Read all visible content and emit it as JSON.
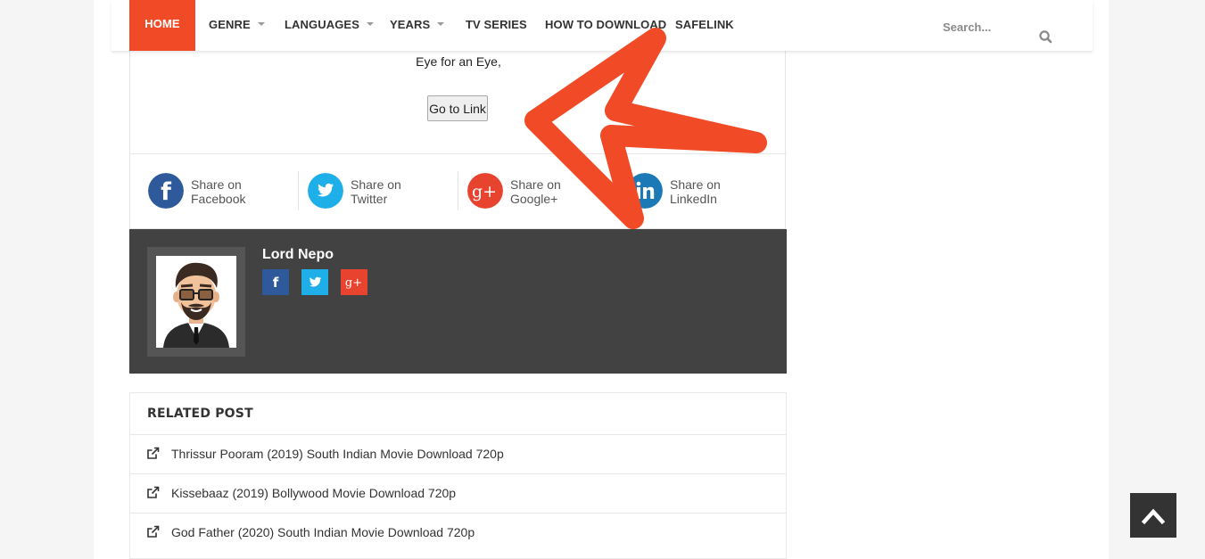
{
  "nav": {
    "items": [
      {
        "label": "HOME",
        "active": true
      },
      {
        "label": "GENRE",
        "dropdown": true
      },
      {
        "label": "LANGUAGES",
        "dropdown": true
      },
      {
        "label": "YEARS",
        "dropdown": true
      },
      {
        "label": "TV SERIES"
      },
      {
        "label": "HOW TO DOWNLOAD"
      },
      {
        "label": "SAFELINK"
      }
    ],
    "search_placeholder": "Search...",
    "accent": "#f04a26"
  },
  "post": {
    "text": "Eye for an Eye,",
    "button_label": "Go to Link"
  },
  "share": {
    "items": [
      {
        "line1": "Share on",
        "line2": "Facebook",
        "icon": "facebook-icon",
        "color": "#2e5a9b"
      },
      {
        "line1": "Share on",
        "line2": "Twitter",
        "icon": "twitter-icon",
        "color": "#1eaee8"
      },
      {
        "line1": "Share on",
        "line2": "Google+",
        "icon": "google-plus-icon",
        "color": "#e8432e"
      },
      {
        "line1": "Share on",
        "line2": "LinkedIn",
        "icon": "linkedin-icon",
        "color": "#1b7ab5"
      }
    ]
  },
  "author": {
    "name": "Lord Nepo",
    "socials": [
      {
        "icon": "facebook-icon",
        "color": "#2e5a9b",
        "glyph": "f"
      },
      {
        "icon": "twitter-icon",
        "color": "#1eaee8",
        "glyph": ""
      },
      {
        "icon": "google-plus-icon",
        "color": "#e8432e",
        "glyph": "g+"
      }
    ]
  },
  "related": {
    "title": "RELATED POST",
    "items": [
      "Thrissur Pooram (2019) South Indian Movie Download 720p",
      "Kissebaaz (2019) Bollywood Movie Download 720p",
      "God Father (2020) South Indian Movie Download 720p"
    ]
  },
  "annotation_arrow_color": "#f04a26"
}
